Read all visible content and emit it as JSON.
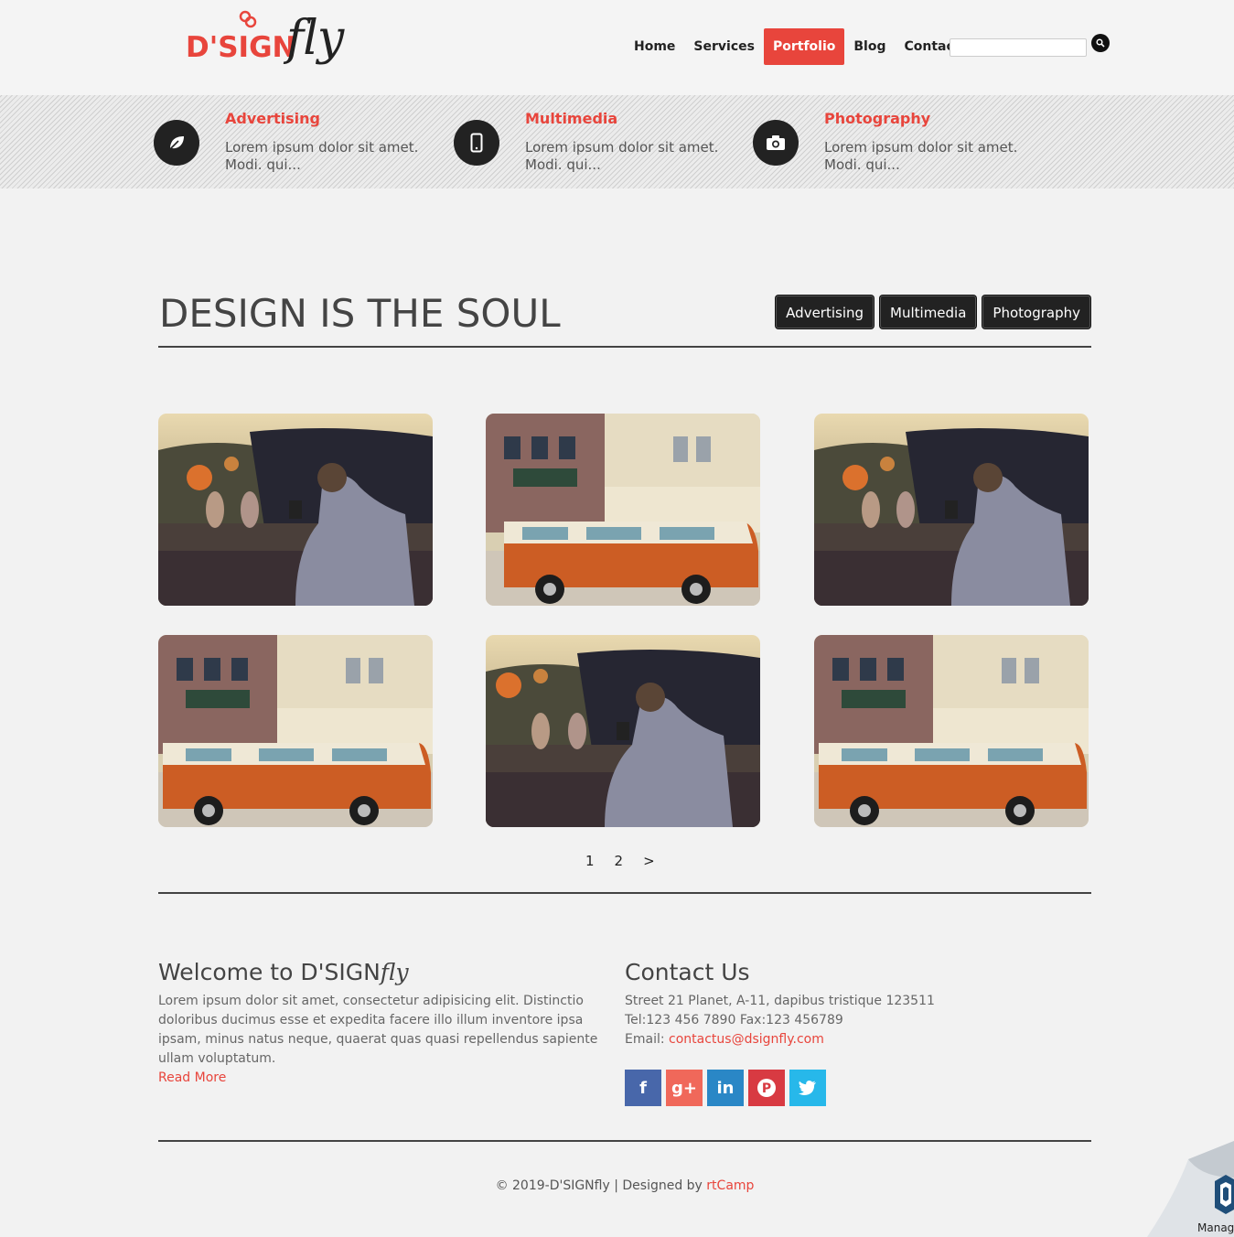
{
  "brand": {
    "logo_main": "D'SIGN",
    "logo_script": "fly",
    "accent_color": "#e8453c"
  },
  "nav": {
    "items": [
      {
        "label": "Home",
        "active": false
      },
      {
        "label": "Services",
        "active": false
      },
      {
        "label": "Portfolio",
        "active": true
      },
      {
        "label": "Blog",
        "active": false
      },
      {
        "label": "Contact",
        "active": false
      }
    ],
    "search_placeholder": "",
    "search_icon": "search-icon"
  },
  "features": [
    {
      "title": "Advertising",
      "text": "Lorem ipsum dolor sit amet. Modi. qui...",
      "icon": "leaf-icon"
    },
    {
      "title": "Multimedia",
      "text": "Lorem ipsum dolor sit amet. Modi. qui...",
      "icon": "mobile-phone-icon"
    },
    {
      "title": "Photography",
      "text": "Lorem ipsum dolor sit amet. Modi. qui...",
      "icon": "camera-icon"
    }
  ],
  "portfolio": {
    "title": "DESIGN IS THE SOUL",
    "filters": [
      "Advertising",
      "Multimedia",
      "Photography"
    ],
    "items": [
      {
        "image": "man-photographing-ostriches"
      },
      {
        "image": "orange-vw-van-street"
      },
      {
        "image": "man-photographing-ostriches"
      },
      {
        "image": "orange-vw-van-street"
      },
      {
        "image": "man-photographing-ostriches"
      },
      {
        "image": "orange-vw-van-street"
      }
    ],
    "pagination": [
      "1",
      "2",
      ">"
    ]
  },
  "footer": {
    "welcome_title": "Welcome to D'SIGN",
    "welcome_title_script": "fly",
    "welcome_text": "Lorem ipsum dolor sit amet, consectetur adipisicing elit. Distinctio doloribus ducimus esse et expedita facere illo illum inventore ipsa ipsam, minus natus neque, quaerat quas quasi repellendus sapiente ullam voluptatum.",
    "read_more": "Read More",
    "contact_title": "Contact Us",
    "address": "Street 21 Planet, A-11, dapibus tristique 123511",
    "phone_fax": "Tel:123 456 7890 Fax:123 456789",
    "email_label": "Email: ",
    "email": "contactus@dsignfly.com",
    "socials": [
      {
        "name": "facebook-icon",
        "glyph": "f",
        "color": "#4867aa"
      },
      {
        "name": "google-plus-icon",
        "glyph": "g+",
        "color": "#f0685a"
      },
      {
        "name": "linkedin-icon",
        "glyph": "in",
        "color": "#2a87c6"
      },
      {
        "name": "pinterest-icon",
        "glyph": "P",
        "color": "#d83a42"
      },
      {
        "name": "twitter-icon",
        "glyph": "t",
        "color": "#27b8ea"
      }
    ],
    "copyright": "© 2019-D'SIGNfly | Designed by ",
    "credit": "rtCamp"
  },
  "corner_badge": {
    "label": "Manag"
  }
}
